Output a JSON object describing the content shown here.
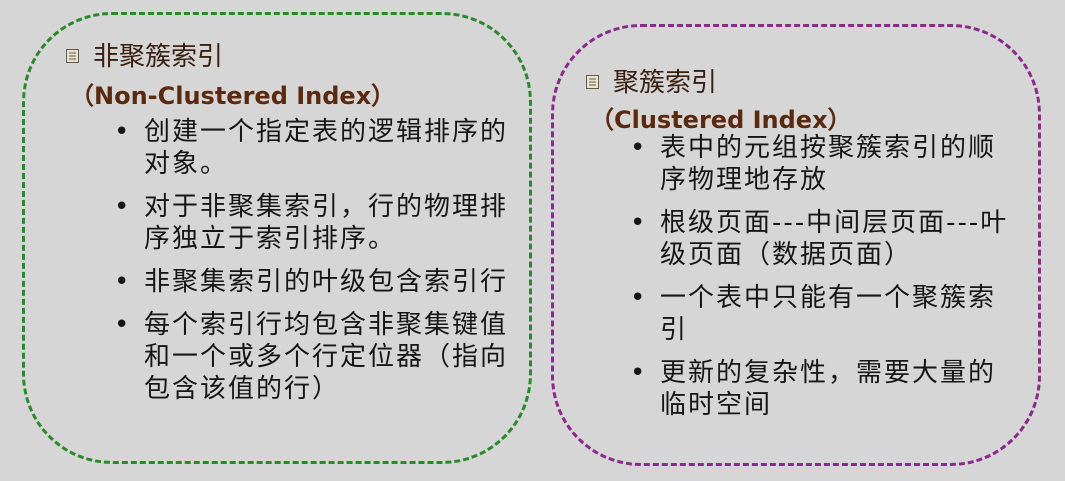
{
  "left": {
    "heading": "非聚簇索引",
    "subheading": "（Non-Clustered Index）",
    "items": [
      "创建一个指定表的逻辑排序的对象。",
      "对于非聚集索引，行的物理排序独立于索引排序。",
      "非聚集索引的叶级包含索引行",
      "每个索引行均包含非聚集键值和一个或多个行定位器（指向包含该值的行）"
    ]
  },
  "right": {
    "heading": "聚簇索引",
    "subheading": "（Clustered Index）",
    "items": [
      "表中的元组按聚簇索引的顺序物理地存放",
      "根级页面---中间层页面---叶级页面（数据页面）",
      "一个表中只能有一个聚簇索引",
      "更新的复杂性，需要大量的临时空间"
    ]
  },
  "bullet": "•",
  "colors": {
    "background": "#d6d6d6",
    "left_border": "#2a8a2a",
    "right_border": "#8a2a8a",
    "heading": "#3a2010",
    "subheading": "#5a2a10"
  }
}
